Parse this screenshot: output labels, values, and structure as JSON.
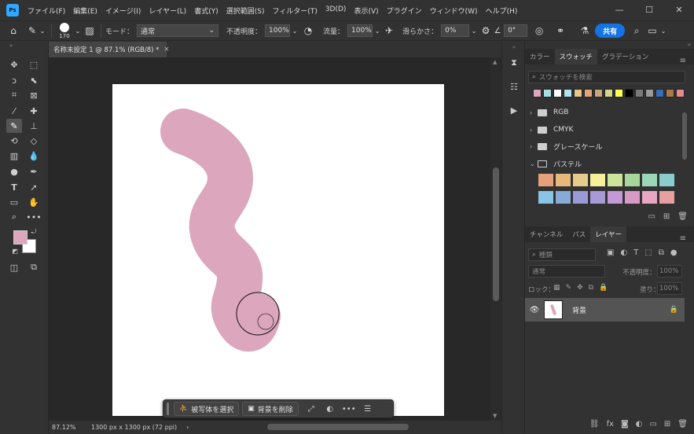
{
  "app": {
    "logo": "Ps"
  },
  "menu": [
    "ファイル(F)",
    "編集(E)",
    "イメージ(I)",
    "レイヤー(L)",
    "書式(Y)",
    "選択範囲(S)",
    "フィルター(T)",
    "3D(D)",
    "表示(V)",
    "プラグイン",
    "ウィンドウ(W)",
    "ヘルプ(H)"
  ],
  "window_controls": {
    "minimize": "—",
    "maximize": "☐",
    "close": "✕"
  },
  "options": {
    "brush_size": "170",
    "mode_label": "モード：",
    "mode_value": "通常",
    "opacity_label": "不透明度：",
    "opacity_value": "100%",
    "flow_label": "流量：",
    "flow_value": "100%",
    "smoothing_label": "滑らかさ：",
    "smoothing_value": "0%",
    "angle_value": "0°",
    "share_label": "共有"
  },
  "document": {
    "tab_title": "名称未設定 1 @ 87.1% (RGB/8) *",
    "tab_close": "×",
    "zoom": "87.12%",
    "info": "1300 px x 1300 px (72 ppi)",
    "status_arrow": "›"
  },
  "taskbar": {
    "select_subject": "被写体を選択",
    "remove_background": "背景を削除",
    "more": "•••"
  },
  "colors": {
    "foreground": "#dca6bd",
    "background": "#ffffff",
    "stroke": "#dca6bd",
    "accent": "#1473e6"
  },
  "swatches_panel": {
    "tabs": [
      "カラー",
      "スウォッチ",
      "グラデーション"
    ],
    "active_tab": "スウォッチ",
    "search_placeholder": "スウォッチを検索",
    "recent": [
      "#dca6bd",
      "#a6e0e0",
      "#ffffff",
      "#b6e3f0",
      "#e6c98a",
      "#e0a67a",
      "#c9a77a",
      "#d6d68a",
      "#ffff55",
      "#000000",
      "#7a7a7a",
      "#9a9a9a",
      "#3a6db8",
      "#a87a4a",
      "#e68a8a"
    ],
    "folders": [
      "RGB",
      "CMYK",
      "グレースケール",
      "パステル"
    ],
    "pastel": [
      "#e6a07a",
      "#e6b87a",
      "#e6cc8a",
      "#f5f09a",
      "#cce39a",
      "#a6d69a",
      "#9ad6b8",
      "#8acccc",
      "#8ac4e6",
      "#8aaad6",
      "#9a9ad6",
      "#a89ad6",
      "#c49ad6",
      "#d69ac4",
      "#e6a6c4",
      "#e6a0a0"
    ]
  },
  "layers_panel": {
    "tabs": [
      "チャンネル",
      "パス",
      "レイヤー"
    ],
    "active_tab": "レイヤー",
    "filter_placeholder": "種類",
    "blend_mode": "通常",
    "opacity_label": "不透明度：",
    "opacity_value": "100%",
    "lock_label": "ロック：",
    "fill_label": "塗り：",
    "fill_value": "100%",
    "layer_name": "背景"
  }
}
